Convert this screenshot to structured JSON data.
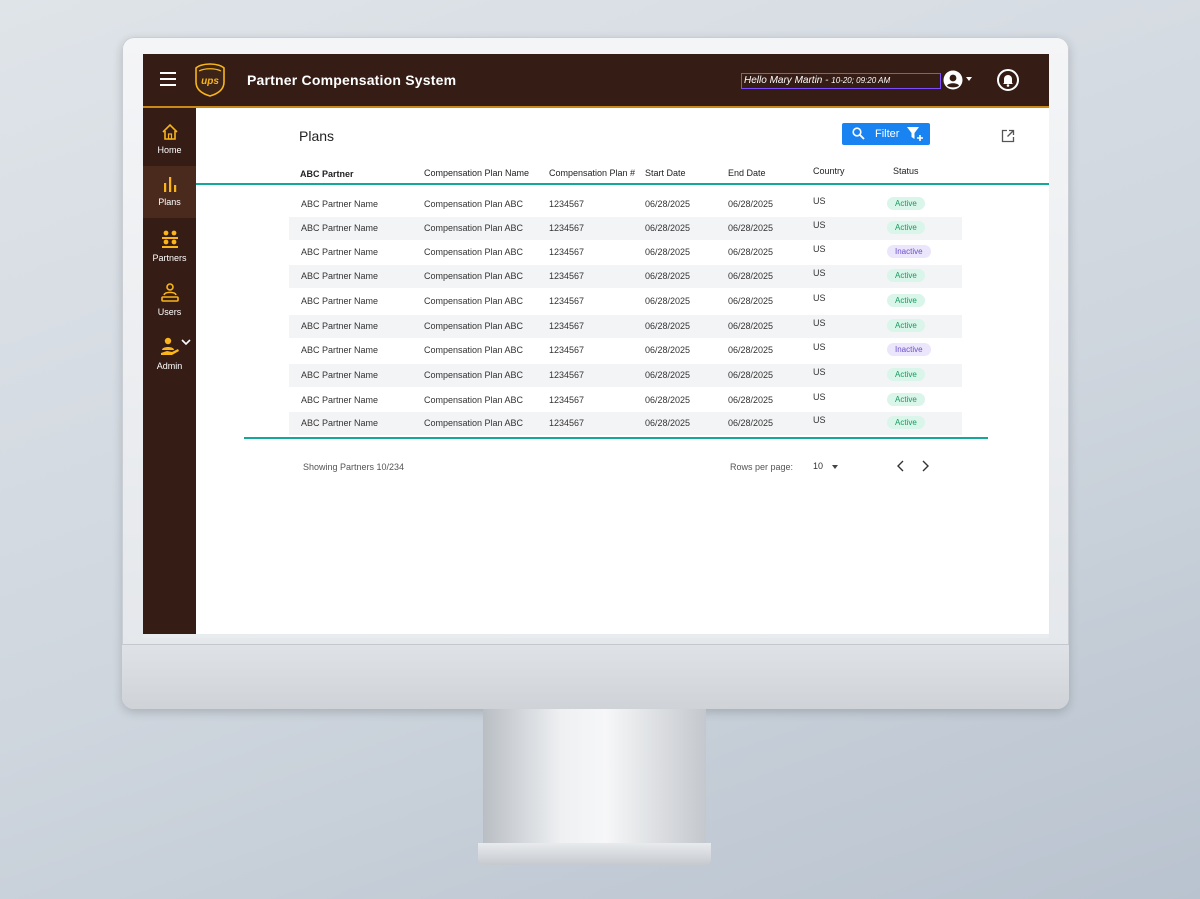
{
  "app": {
    "title": "Partner Compensation System",
    "greeting_name": "Hello Mary Martin",
    "greeting_sep": " - ",
    "greeting_time": "10-20; 09:20 AM"
  },
  "sidebar": {
    "items": [
      {
        "label": "Home",
        "icon": "home-icon"
      },
      {
        "label": "Plans",
        "icon": "bar-chart-icon",
        "active": true
      },
      {
        "label": "Partners",
        "icon": "partners-icon"
      },
      {
        "label": "Users",
        "icon": "users-icon"
      },
      {
        "label": "Admin",
        "icon": "admin-icon"
      }
    ]
  },
  "page": {
    "title": "Plans",
    "filter_label": "Filter"
  },
  "table": {
    "columns": [
      "ABC Partner",
      "Compensation Plan Name",
      "Compensation Plan #",
      "Start Date",
      "End Date",
      "Country",
      "Status"
    ],
    "rows": [
      [
        "ABC Partner Name",
        "Compensation Plan ABC",
        "1234567",
        "06/28/2025",
        "06/28/2025",
        "US",
        "Active"
      ],
      [
        "ABC Partner Name",
        "Compensation Plan ABC",
        "1234567",
        "06/28/2025",
        "06/28/2025",
        "US",
        "Active"
      ],
      [
        "ABC Partner Name",
        "Compensation Plan ABC",
        "1234567",
        "06/28/2025",
        "06/28/2025",
        "US",
        "Inactive"
      ],
      [
        "ABC Partner Name",
        "Compensation Plan ABC",
        "1234567",
        "06/28/2025",
        "06/28/2025",
        "US",
        "Active"
      ],
      [
        "ABC Partner Name",
        "Compensation Plan ABC",
        "1234567",
        "06/28/2025",
        "06/28/2025",
        "US",
        "Active"
      ],
      [
        "ABC Partner Name",
        "Compensation Plan ABC",
        "1234567",
        "06/28/2025",
        "06/28/2025",
        "US",
        "Active"
      ],
      [
        "ABC Partner Name",
        "Compensation Plan ABC",
        "1234567",
        "06/28/2025",
        "06/28/2025",
        "US",
        "Inactive"
      ],
      [
        "ABC Partner Name",
        "Compensation Plan ABC",
        "1234567",
        "06/28/2025",
        "06/28/2025",
        "US",
        "Active"
      ],
      [
        "ABC Partner Name",
        "Compensation Plan ABC",
        "1234567",
        "06/28/2025",
        "06/28/2025",
        "US",
        "Active"
      ],
      [
        "ABC Partner Name",
        "Compensation Plan ABC",
        "1234567",
        "06/28/2025",
        "06/28/2025",
        "US",
        "Active"
      ]
    ]
  },
  "pagination": {
    "showing": "Showing Partners 10/234",
    "rows_per_page_label": "Rows per page:",
    "rows_per_page_value": "10"
  },
  "colors": {
    "brand_brown": "#351c15",
    "brand_gold": "#f9b51a",
    "accent_blue": "#1a83f2",
    "divider_teal": "#14a89a",
    "active_green": "#169a60",
    "inactive_purple": "#6a4fc9"
  }
}
